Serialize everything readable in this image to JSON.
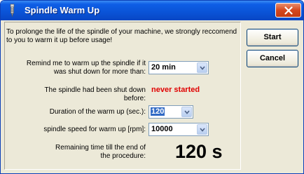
{
  "window": {
    "title": "Spindle Warm Up",
    "intro": "To prolonge the life of the spindle of your machine, we strongly reccomend to you to warm it up before usage!"
  },
  "remind": {
    "label_line1": "Remind me to warm up the spindle if it",
    "label_line2": "was shut down for more than:",
    "value": "20 min"
  },
  "shutdown": {
    "label_line1": "The spindle had been shut down",
    "label_line2": "before:",
    "value": "never started"
  },
  "duration": {
    "label": "Duration of the warm up (sec.):",
    "value": "120"
  },
  "speed": {
    "label": "spindle speed for warm up [rpm]:",
    "value": "10000"
  },
  "remaining": {
    "label_line1": "Remaining time till the end of",
    "label_line2": "the procedure:",
    "value": "120 s"
  },
  "buttons": {
    "start": "Start",
    "cancel": "Cancel"
  },
  "colors": {
    "titlebar": "#0a53d6",
    "warning_text": "#e00000",
    "dialog_bg": "#ece9d8"
  },
  "icons": {
    "title": "spindle-icon",
    "close": "close-icon",
    "dropdown": "chevron-down-icon"
  }
}
